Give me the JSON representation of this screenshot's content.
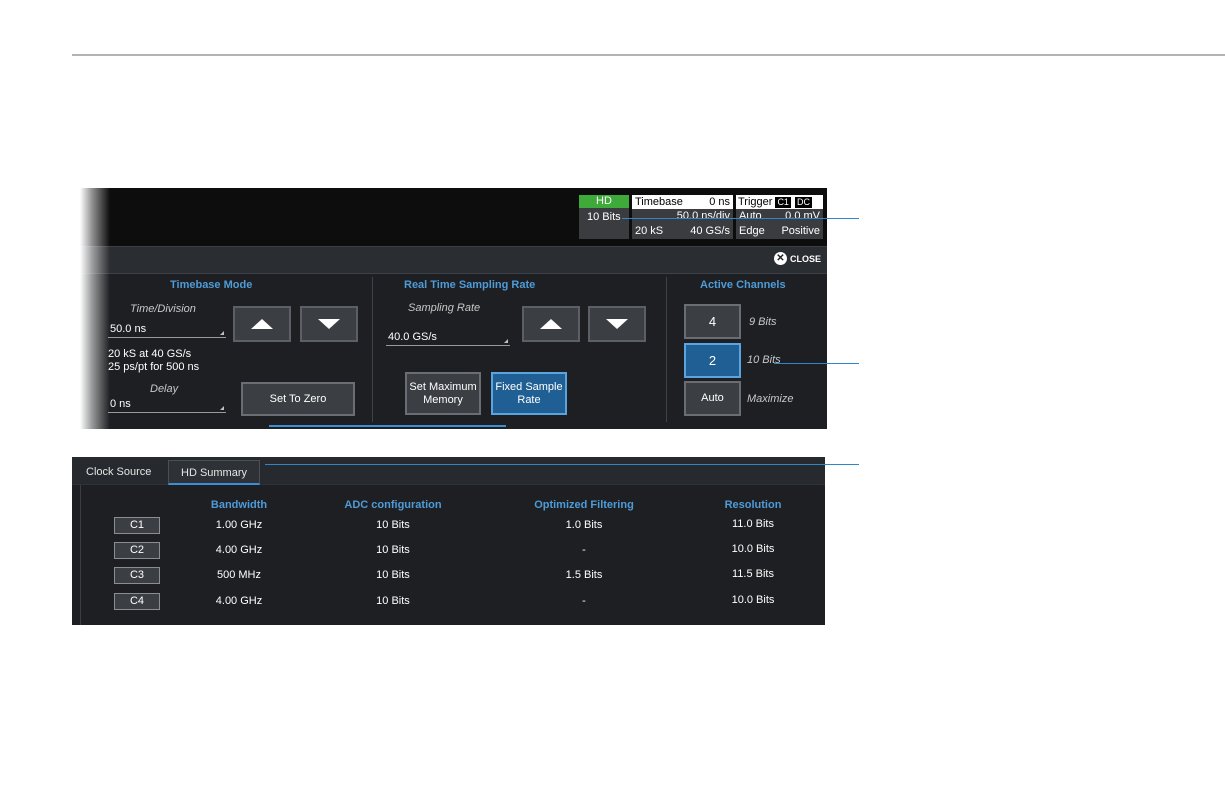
{
  "status_bar": {
    "hd": {
      "label": "HD",
      "bits": "10 Bits"
    },
    "timebase": {
      "title": "Timebase",
      "delay": "0 ns",
      "per_div": "50.0 ns/div",
      "samples": "20 kS",
      "rate": "40 GS/s"
    },
    "trigger": {
      "title": "Trigger",
      "source_tag": "C1",
      "coupling_tag": "DC",
      "mode": "Auto",
      "level": "0.0 mV",
      "type": "Edge",
      "slope": "Positive"
    }
  },
  "dialog": {
    "close_label": "CLOSE",
    "timebase_mode": {
      "title": "Timebase Mode",
      "time_division_label": "Time/Division",
      "time_division_value": "50.0 ns",
      "info_line1": "20 kS at 40 GS/s",
      "info_line2": "25 ps/pt for 500 ns",
      "delay_label": "Delay",
      "delay_value": "0 ns",
      "set_to_zero_label": "Set To Zero"
    },
    "sampling": {
      "title": "Real Time Sampling Rate",
      "rate_label": "Sampling Rate",
      "rate_value": "40.0 GS/s",
      "set_max_memory_label": "Set Maximum Memory",
      "fixed_sample_rate_label": "Fixed Sample Rate"
    },
    "active_channels": {
      "title": "Active Channels",
      "options": [
        {
          "count": "4",
          "bits": "9 Bits"
        },
        {
          "count": "2",
          "bits": "10 Bits"
        },
        {
          "count": "Auto",
          "bits": "Maximize"
        }
      ],
      "selected_index": 1
    }
  },
  "summary": {
    "tabs": [
      {
        "label": "Clock Source"
      },
      {
        "label": "HD Summary"
      }
    ],
    "active_tab": "HD Summary",
    "columns": [
      "Bandwidth",
      "ADC configuration",
      "Optimized Filtering",
      "Resolution"
    ],
    "rows": [
      {
        "channel": "C1",
        "bandwidth": "1.00 GHz",
        "adc": "10 Bits",
        "filtering": "1.0 Bits",
        "resolution": "11.0 Bits"
      },
      {
        "channel": "C2",
        "bandwidth": "4.00 GHz",
        "adc": "10 Bits",
        "filtering": "-",
        "resolution": "10.0 Bits"
      },
      {
        "channel": "C3",
        "bandwidth": "500 MHz",
        "adc": "10 Bits",
        "filtering": "1.5 Bits",
        "resolution": "11.5 Bits"
      },
      {
        "channel": "C4",
        "bandwidth": "4.00 GHz",
        "adc": "10 Bits",
        "filtering": "-",
        "resolution": "10.0 Bits"
      }
    ]
  },
  "colors": {
    "panel_bg": "#1d1f22",
    "accent_blue": "#4f9bd8",
    "hd_green": "#3daa3a",
    "selected_button": "#1f5f93",
    "callout_line": "#2f86c9"
  }
}
